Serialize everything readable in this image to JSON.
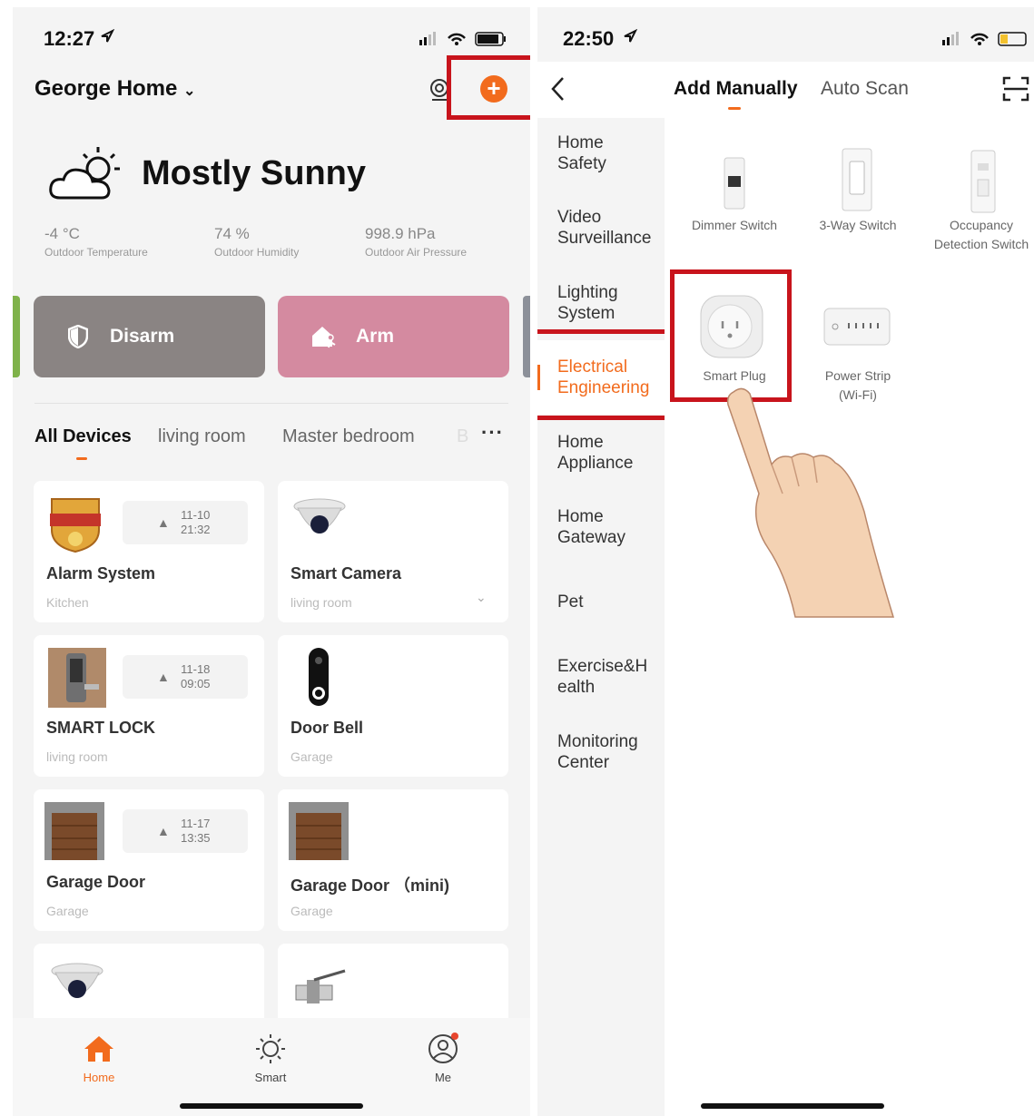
{
  "left": {
    "status_time": "12:27",
    "home_name": "George Home",
    "weather": {
      "condition": "Mostly Sunny",
      "temperature": "-4 °C",
      "temperature_label": "Outdoor Temperature",
      "humidity": "74 %",
      "humidity_label": "Outdoor Humidity",
      "pressure": "998.9 hPa",
      "pressure_label": "Outdoor Air Pressure"
    },
    "disarm_label": "Disarm",
    "arm_label": "Arm",
    "tabs": [
      "All Devices",
      "living room",
      "Master bedroom",
      "B"
    ],
    "devices": [
      {
        "name": "Alarm System",
        "room": "Kitchen",
        "date": "11-10",
        "time": "21:32"
      },
      {
        "name": "Smart Camera",
        "room": "living room"
      },
      {
        "name": "SMART LOCK",
        "room": "living room",
        "date": "11-18",
        "time": "09:05"
      },
      {
        "name": "Door Bell",
        "room": "Garage"
      },
      {
        "name": "Garage Door",
        "room": "Garage",
        "date": "11-17",
        "time": "13:35"
      },
      {
        "name": "Garage Door （mini)",
        "room": "Garage"
      }
    ],
    "nav": [
      "Home",
      "Smart",
      "Me"
    ],
    "accent_color": "#f26b1d"
  },
  "right": {
    "status_time": "22:50",
    "tab_manual": "Add Manually",
    "tab_scan": "Auto Scan",
    "categories": [
      "Home Safety",
      "Video Surveillance",
      "Lighting System",
      "Electrical Engineering",
      "Home Appliance",
      "Home Gateway",
      "Pet",
      "Exercise&Health",
      "Monitoring Center"
    ],
    "categories_display": [
      [
        "Home",
        "Safety"
      ],
      [
        "Video",
        "Surveillance"
      ],
      [
        "Lighting",
        "System"
      ],
      [
        "Electrical",
        "Engineering"
      ],
      [
        "Home",
        "Appliance"
      ],
      [
        "Home",
        "Gateway"
      ],
      [
        "Pet"
      ],
      [
        "Exercise&H",
        "ealth"
      ],
      [
        "Monitoring",
        "Center"
      ]
    ],
    "selected_category": "Electrical Engineering",
    "products": [
      {
        "name": "Dimmer Switch"
      },
      {
        "name": "3-Way Switch"
      },
      {
        "name": "Occupancy Detection Switch",
        "lines": [
          "Occupancy",
          "Detection Switch"
        ]
      },
      {
        "name": "Smart Plug"
      },
      {
        "name": "Power Strip (Wi-Fi)",
        "lines": [
          "Power Strip",
          "(Wi-Fi)"
        ]
      }
    ]
  }
}
